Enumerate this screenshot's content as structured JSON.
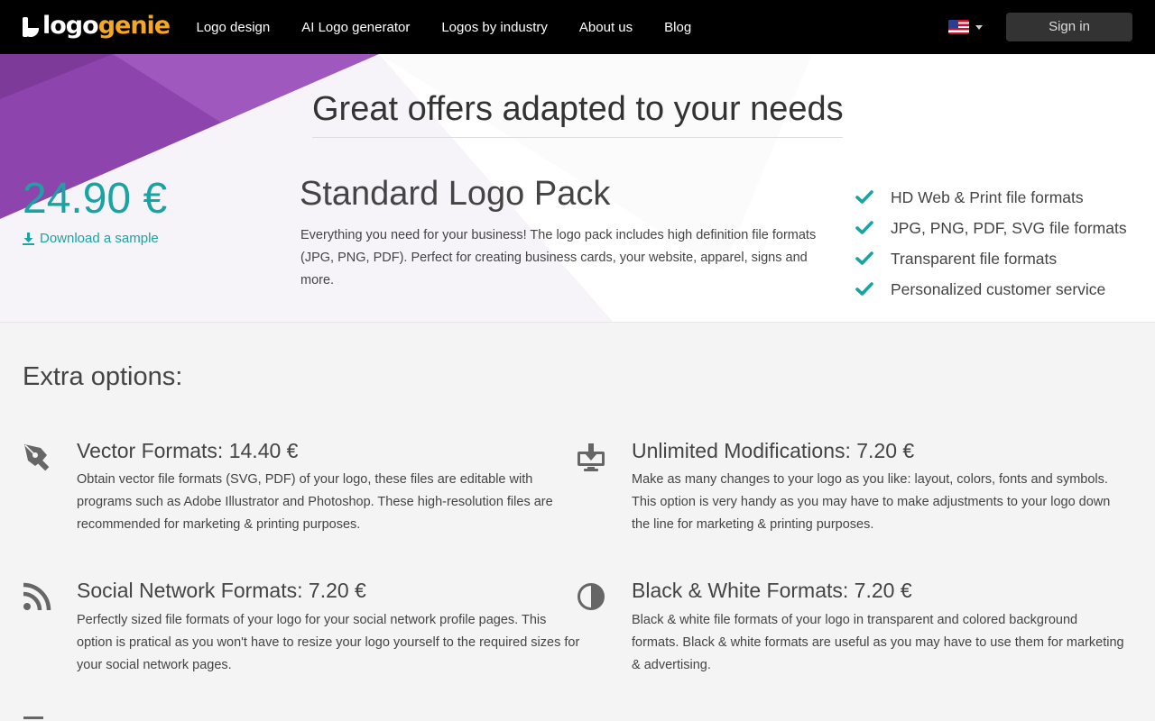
{
  "nav": {
    "logo": {
      "part1": "logo",
      "part2": "genie"
    },
    "links": [
      "Logo design",
      "AI Logo generator",
      "Logos by industry",
      "About us",
      "Blog"
    ],
    "language": "us-flag-icon",
    "signin_label": "Sign in"
  },
  "hero": {
    "title": "Great offers adapted to your needs",
    "price": "24.90 €",
    "sample_link": "Download a sample",
    "pack_title": "Standard Logo Pack",
    "pack_description": "Everything you need for your business! The logo pack includes high definition file formats (JPG, PNG, PDF). Perfect for creating business cards, your website, apparel, signs and more.",
    "features": [
      "HD Web & Print file formats",
      "JPG, PNG, PDF, SVG file formats",
      "Transparent file formats",
      "Personalized customer service"
    ]
  },
  "extras": {
    "title": "Extra options:",
    "options": [
      {
        "icon": "pen-nib-icon",
        "title": "Vector Formats: 14.40 €",
        "description": "Obtain vector file formats (SVG, PDF) of your logo, these files are editable with programs such as Adobe Illustrator and Photoshop. These high-resolution files are recommended for marketing & printing purposes."
      },
      {
        "icon": "monitor-download-icon",
        "title": "Unlimited Modifications: 7.20 €",
        "description": "Make as many changes to your logo as you like: layout, colors, fonts and symbols. This option is very handy as you may have to make adjustments to your logo down the line for marketing & printing purposes."
      },
      {
        "icon": "rss-icon",
        "title": "Social Network Formats: 7.20 €",
        "description": "Perfectly sized file formats of your logo for your social network profile pages. This option is pratical as you won't have to resize your logo yourself to the required sizes for your social network pages."
      },
      {
        "icon": "half-circle-icon",
        "title": "Black & White Formats: 7.20 €",
        "description": "Black & white file formats of your logo in transparent and colored background formats. Black & white formats are useful as you may have to use them for marketing & advertising."
      }
    ]
  },
  "colors": {
    "accent": "#1aa3a3",
    "purple": "#8e44ad",
    "logo_orange": "#f5a623",
    "nav_bg": "#000000"
  }
}
